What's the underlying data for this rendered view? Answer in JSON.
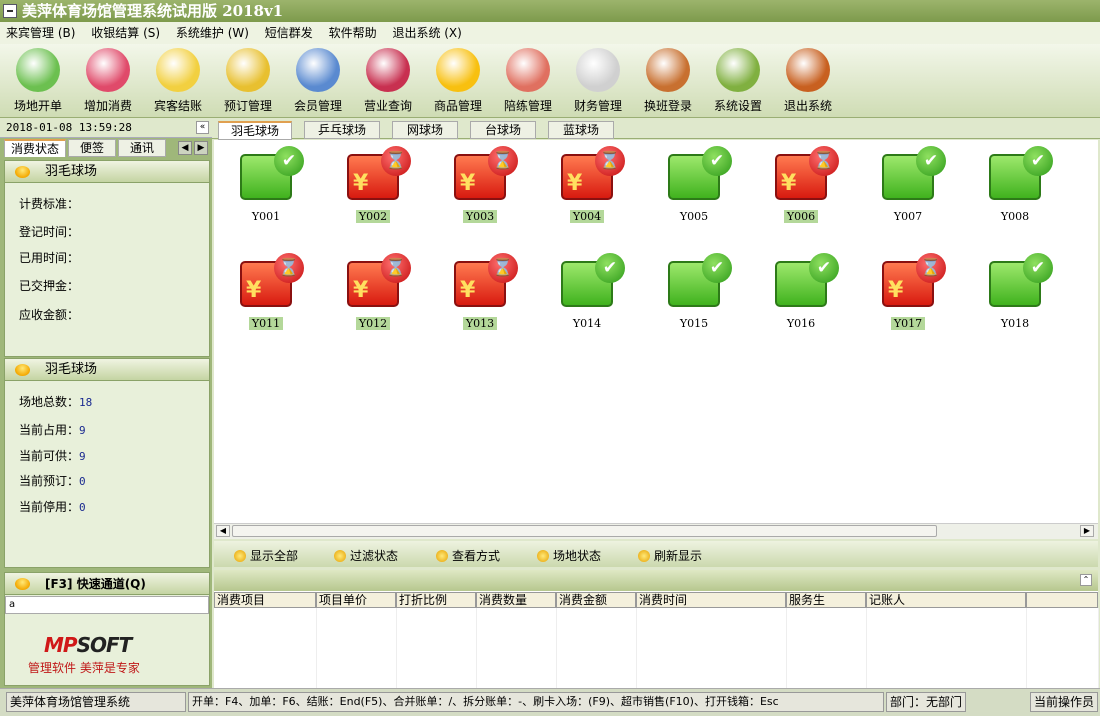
{
  "title": "美萍体育场馆管理系统试用版 2018v1",
  "menu": [
    "来宾管理 (B)",
    "收银结算 (S)",
    "系统维护 (W)",
    "短信群发",
    "软件帮助",
    "退出系统 (X)"
  ],
  "toolbar": [
    {
      "label": "场地开单",
      "icon": "user-icon",
      "color": "#6cc050"
    },
    {
      "label": "增加消费",
      "icon": "add-icon",
      "color": "#e04a6a"
    },
    {
      "label": "宾客结账",
      "icon": "checkout-arrow-icon",
      "color": "#f2d040"
    },
    {
      "label": "预订管理",
      "icon": "clock-icon",
      "color": "#e8c030"
    },
    {
      "label": "会员管理",
      "icon": "members-icon",
      "color": "#5a8ad0"
    },
    {
      "label": "营业查询",
      "icon": "notebook-icon",
      "color": "#c83050"
    },
    {
      "label": "商品管理",
      "icon": "star-icon",
      "color": "#f8c010"
    },
    {
      "label": "陪练管理",
      "icon": "group-icon",
      "color": "#e07060"
    },
    {
      "label": "财务管理",
      "icon": "calculator-icon",
      "color": "#d0d0d0"
    },
    {
      "label": "换班登录",
      "icon": "exit-door-person-icon",
      "color": "#c87030"
    },
    {
      "label": "系统设置",
      "icon": "gear-icon",
      "color": "#80b040"
    },
    {
      "label": "退出系统",
      "icon": "exit-door-icon",
      "color": "#c86020"
    }
  ],
  "datetime": "2018-01-08 13:59:28",
  "left_tabs": [
    "消费状态",
    "便签",
    "通讯"
  ],
  "info_panel": {
    "title": "羽毛球场",
    "fields": [
      "计费标准：",
      "登记时间：",
      "已用时间：",
      "已交押金：",
      "应收金额："
    ]
  },
  "stats_panel": {
    "title": "羽毛球场",
    "rows": [
      {
        "label": "场地总数：",
        "value": "18"
      },
      {
        "label": "当前占用：",
        "value": "9"
      },
      {
        "label": "当前可供：",
        "value": "9"
      },
      {
        "label": "当前预订：",
        "value": "0"
      },
      {
        "label": "当前停用：",
        "value": "0"
      }
    ]
  },
  "quick": {
    "title": "[F3] 快速通道(Q)",
    "value": "a"
  },
  "logo": {
    "brand": "MPSOFT",
    "slogan": "管理软件 美萍是专家"
  },
  "venue_tabs": [
    "羽毛球场",
    "乒乓球场",
    "网球场",
    "台球场",
    "蓝球场"
  ],
  "courts": [
    {
      "id": "Y001",
      "status": "free"
    },
    {
      "id": "Y002",
      "status": "busy"
    },
    {
      "id": "Y003",
      "status": "busy"
    },
    {
      "id": "Y004",
      "status": "busy"
    },
    {
      "id": "Y005",
      "status": "free"
    },
    {
      "id": "Y006",
      "status": "busy"
    },
    {
      "id": "Y007",
      "status": "free"
    },
    {
      "id": "Y008",
      "status": "free"
    },
    {
      "id": "Y011",
      "status": "busy"
    },
    {
      "id": "Y012",
      "status": "busy"
    },
    {
      "id": "Y013",
      "status": "busy"
    },
    {
      "id": "Y014",
      "status": "free"
    },
    {
      "id": "Y015",
      "status": "free"
    },
    {
      "id": "Y016",
      "status": "free"
    },
    {
      "id": "Y017",
      "status": "busy"
    },
    {
      "id": "Y018",
      "status": "free"
    }
  ],
  "actions": [
    "显示全部",
    "过滤状态",
    "查看方式",
    "场地状态",
    "刷新显示"
  ],
  "columns": [
    "消费项目",
    "项目单价",
    "打折比例",
    "消费数量",
    "消费金额",
    "消费时间",
    "服务生",
    "记账人",
    ""
  ],
  "status": {
    "app": "美萍体育场馆管理系统",
    "shortcuts": "开单：F4、加单：F6、结账：End(F5)、合并账单：/、拆分账单：-、刷卡入场：(F9)、超市销售(F10)、打开钱箱：Esc",
    "dept": "部门：无部门",
    "op": "当前操作员"
  }
}
